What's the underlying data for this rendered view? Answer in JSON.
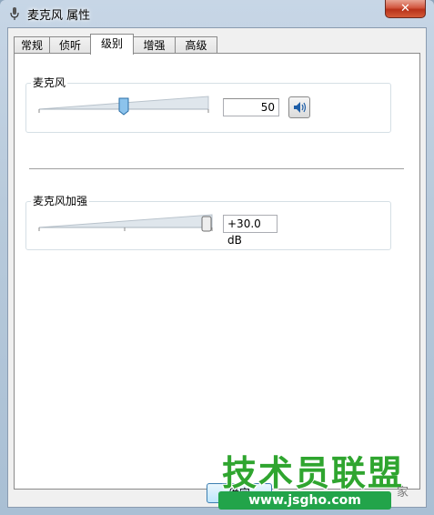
{
  "window": {
    "title": "麦克风 属性",
    "close_label": "✕"
  },
  "tabs": [
    {
      "label": "常规",
      "active": false
    },
    {
      "label": "侦听",
      "active": false
    },
    {
      "label": "级别",
      "active": true
    },
    {
      "label": "增强",
      "active": false
    },
    {
      "label": "高级",
      "active": false
    }
  ],
  "microphone": {
    "group_label": "麦克风",
    "level_value": "50",
    "level_percent": 50,
    "speaker_icon": "speaker-icon"
  },
  "boost": {
    "group_label": "麦克风加强",
    "value": "+30.0 dB",
    "level_fraction": 1.0
  },
  "buttons": {
    "ok_label": "确定"
  },
  "watermark": {
    "brand": "技术员联盟",
    "url": "www.jsgho.com",
    "corner": "家"
  },
  "colors": {
    "tab_border": "#8a8a8a",
    "slider_thumb": "#5aa0d8",
    "watermark_green": "#2fa52f"
  }
}
